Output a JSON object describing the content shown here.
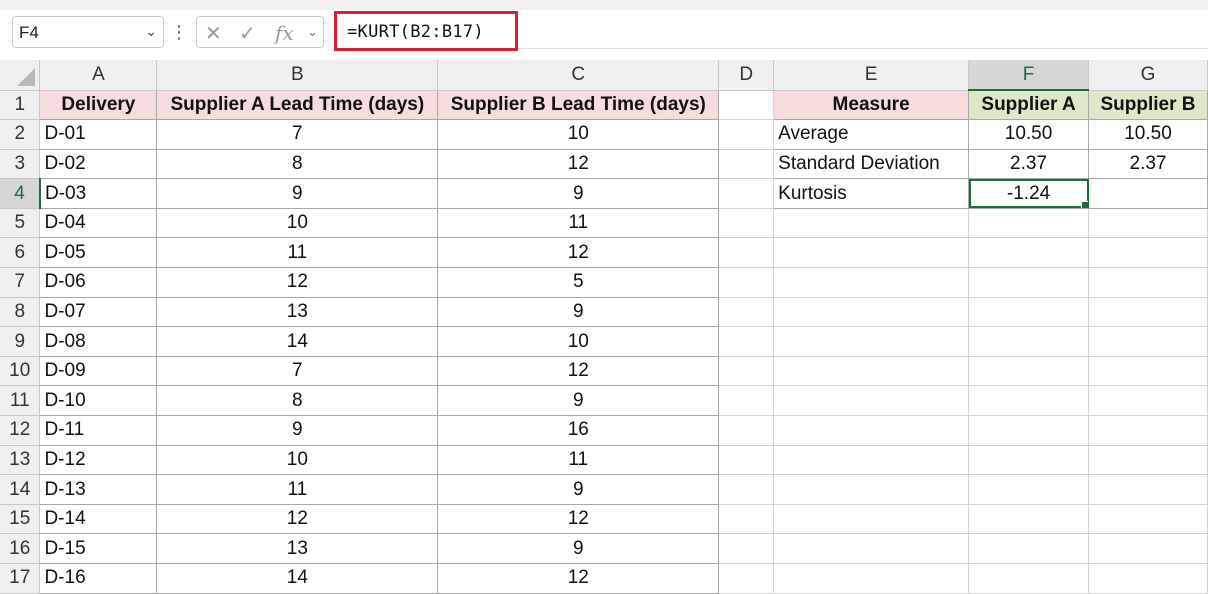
{
  "formula_bar": {
    "name_box": "F4",
    "formula": "=KURT(B2:B17)",
    "cancel_icon": "close-icon",
    "enter_icon": "check-icon",
    "fx_label": "fx"
  },
  "columns": [
    "A",
    "B",
    "C",
    "D",
    "E",
    "F",
    "G"
  ],
  "rows": [
    "1",
    "2",
    "3",
    "4",
    "5",
    "6",
    "7",
    "8",
    "9",
    "10",
    "11",
    "12",
    "13",
    "14",
    "15",
    "16",
    "17"
  ],
  "table1": {
    "headers": [
      "Delivery",
      "Supplier A Lead Time (days)",
      "Supplier B Lead Time (days)"
    ],
    "data": [
      [
        "D-01",
        "7",
        "10"
      ],
      [
        "D-02",
        "8",
        "12"
      ],
      [
        "D-03",
        "9",
        "9"
      ],
      [
        "D-04",
        "10",
        "11"
      ],
      [
        "D-05",
        "11",
        "12"
      ],
      [
        "D-06",
        "12",
        "5"
      ],
      [
        "D-07",
        "13",
        "9"
      ],
      [
        "D-08",
        "14",
        "10"
      ],
      [
        "D-09",
        "7",
        "12"
      ],
      [
        "D-10",
        "8",
        "9"
      ],
      [
        "D-11",
        "9",
        "16"
      ],
      [
        "D-12",
        "10",
        "11"
      ],
      [
        "D-13",
        "11",
        "9"
      ],
      [
        "D-14",
        "12",
        "12"
      ],
      [
        "D-15",
        "13",
        "9"
      ],
      [
        "D-16",
        "14",
        "12"
      ]
    ]
  },
  "table2": {
    "headers": [
      "Measure",
      "Supplier A",
      "Supplier B"
    ],
    "data": [
      [
        "Average",
        "10.50",
        "10.50"
      ],
      [
        "Standard Deviation",
        "2.37",
        "2.37"
      ],
      [
        "Kurtosis",
        "-1.24",
        ""
      ]
    ]
  },
  "colors": {
    "header_pink": "#f6dcdc",
    "header_green": "#dde8c8",
    "selection": "#1e6b3c",
    "formula_highlight": "#d6203b"
  }
}
